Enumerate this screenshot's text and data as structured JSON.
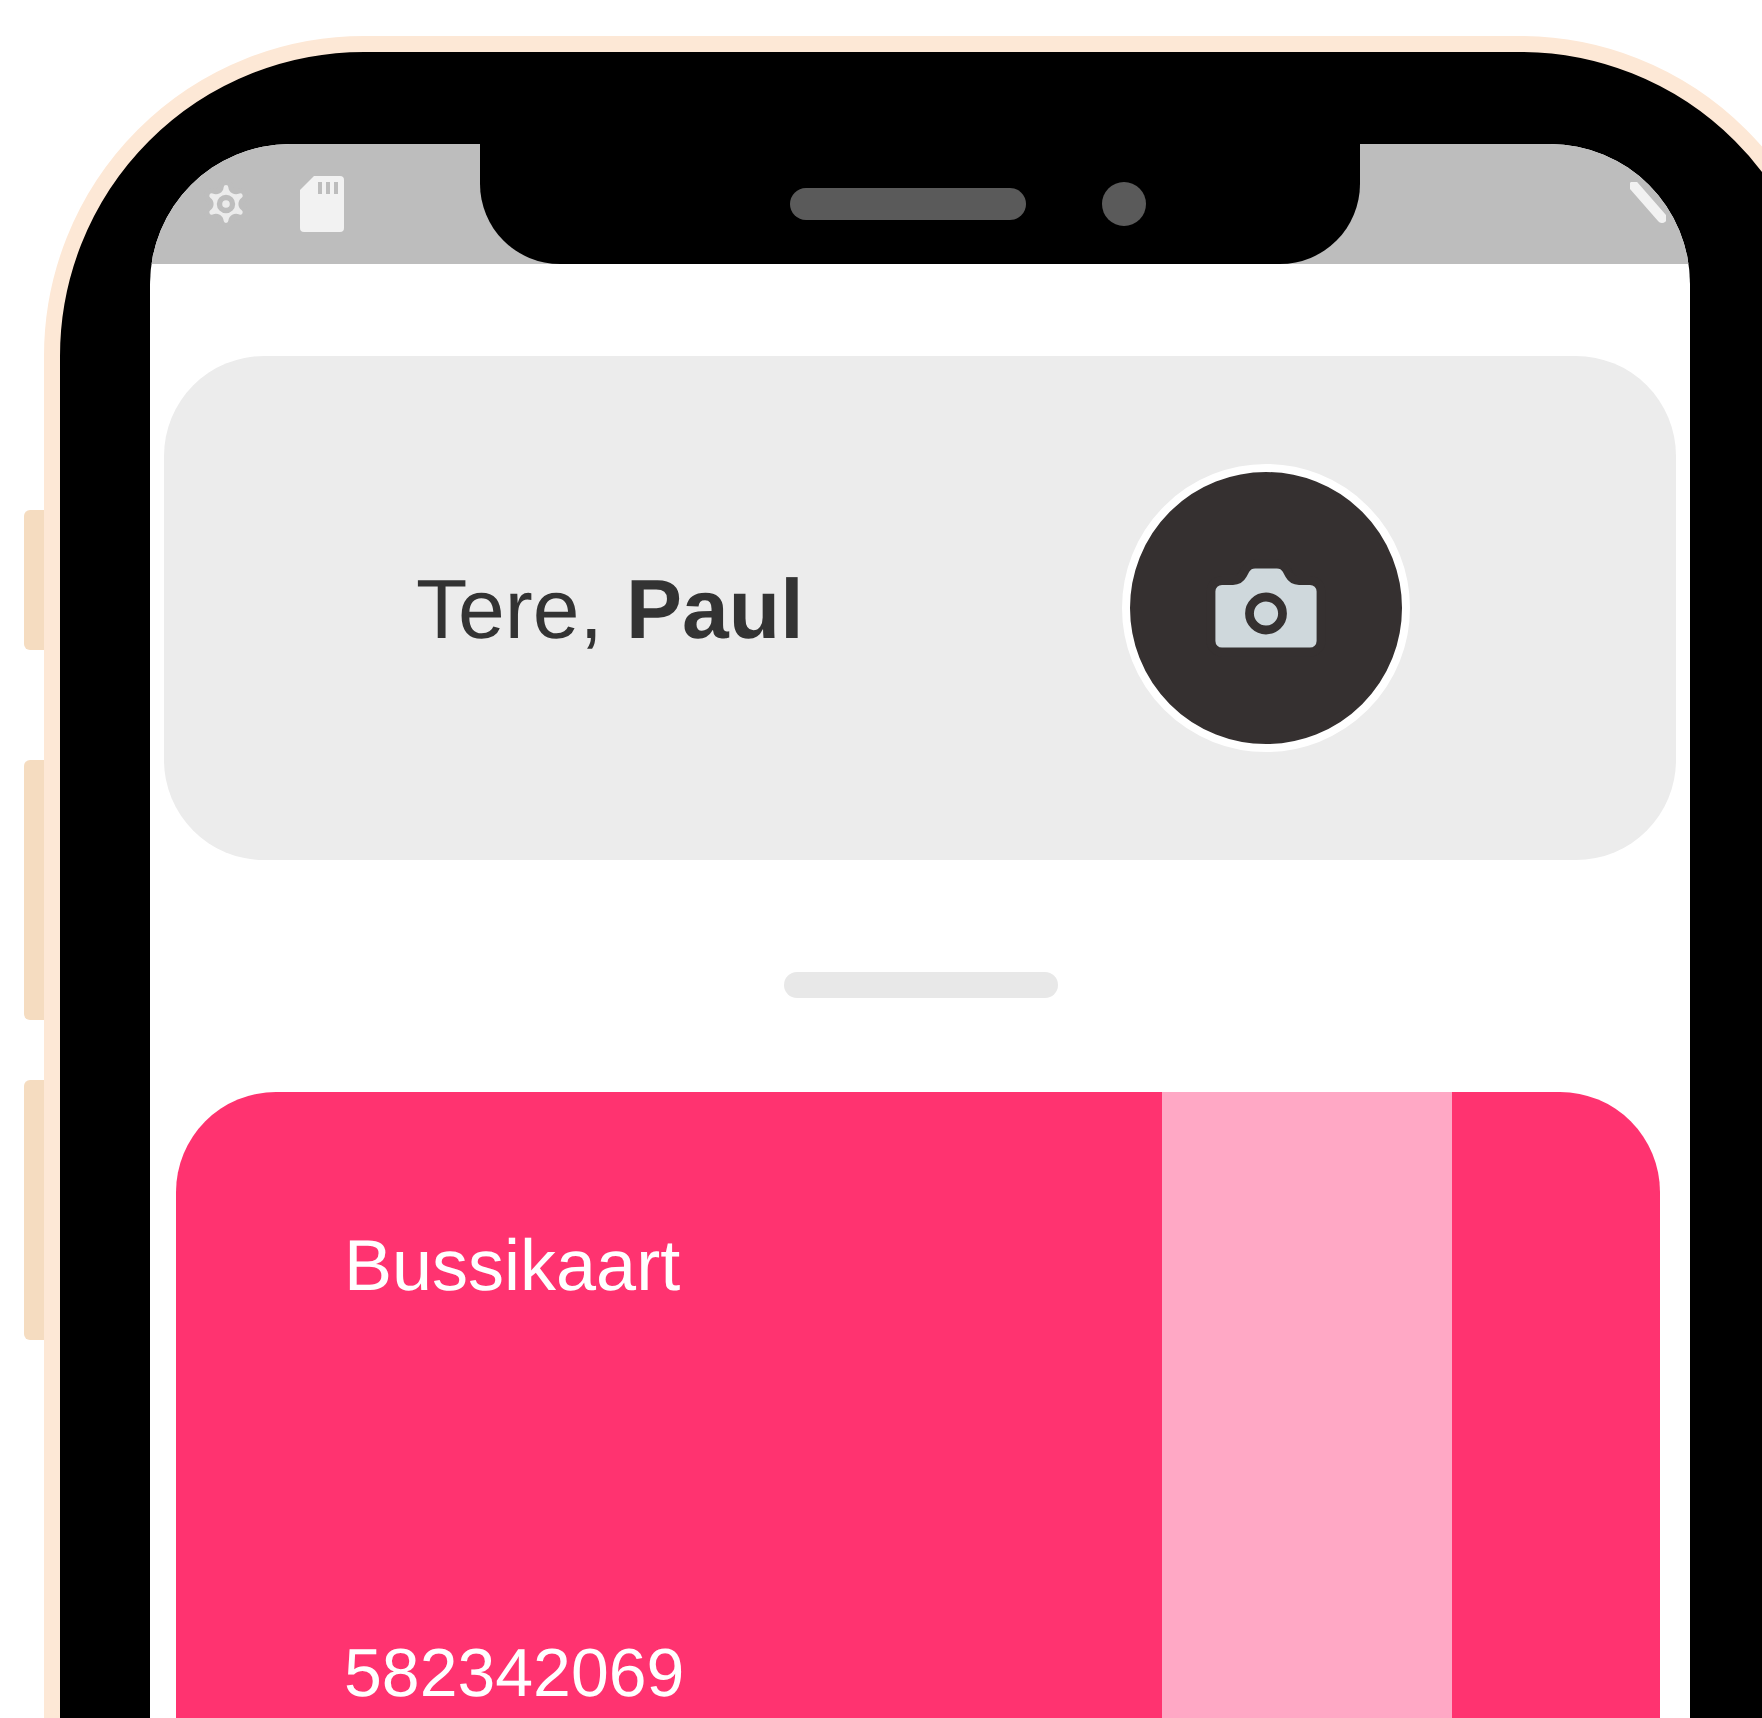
{
  "greeting": {
    "text": "Tere, **Paul**"
  },
  "card": {
    "title": "Bussikaart",
    "number": "582342069"
  }
}
